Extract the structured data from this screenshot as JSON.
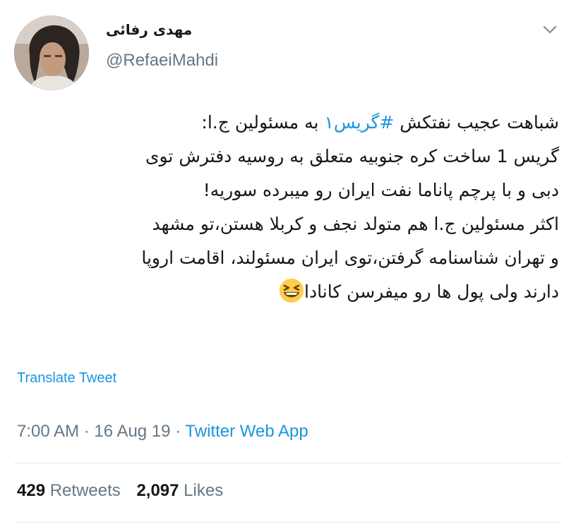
{
  "user": {
    "display_name": "مهدی رفائی",
    "handle": "@RefaeiMahdi",
    "avatar_icon": "profile-photo",
    "menu_icon": "chevron-down-icon"
  },
  "tweet": {
    "lines": {
      "l1_pre": "شباهت عجیب نفتکش ",
      "l1_hashtag": "#گریس۱",
      "l1_post": " به مسئولین ج.ا:",
      "l2": "گریس 1 ساخت کره جنوبیه متعلق به روسیه دفترش توی",
      "l3": "دبی و با پرچم پاناما نفت ایران رو میبرده سوریه!",
      "l4": "اکثر مسئولین ج.ا هم متولد نجف و کربلا هستن،تو مشهد",
      "l5": "و تهران شناسنامه گرفتن،توی ایران مسئولند، اقامت اروپا",
      "l6": "دارند ولی پول ها رو میفرسن کانادا"
    },
    "emoji": "grinning-squinting-face-emoji",
    "translate_label": "Translate Tweet",
    "time": "7:00 AM",
    "separator": "·",
    "date": "16 Aug 19",
    "source": "Twitter Web App"
  },
  "stats": {
    "retweets_count": "429",
    "retweets_label": "Retweets",
    "likes_count": "2,097",
    "likes_label": "Likes"
  },
  "colors": {
    "link": "#1b95e0",
    "secondary": "#657786",
    "primary": "#14171a",
    "divider": "#e1e8ed"
  }
}
